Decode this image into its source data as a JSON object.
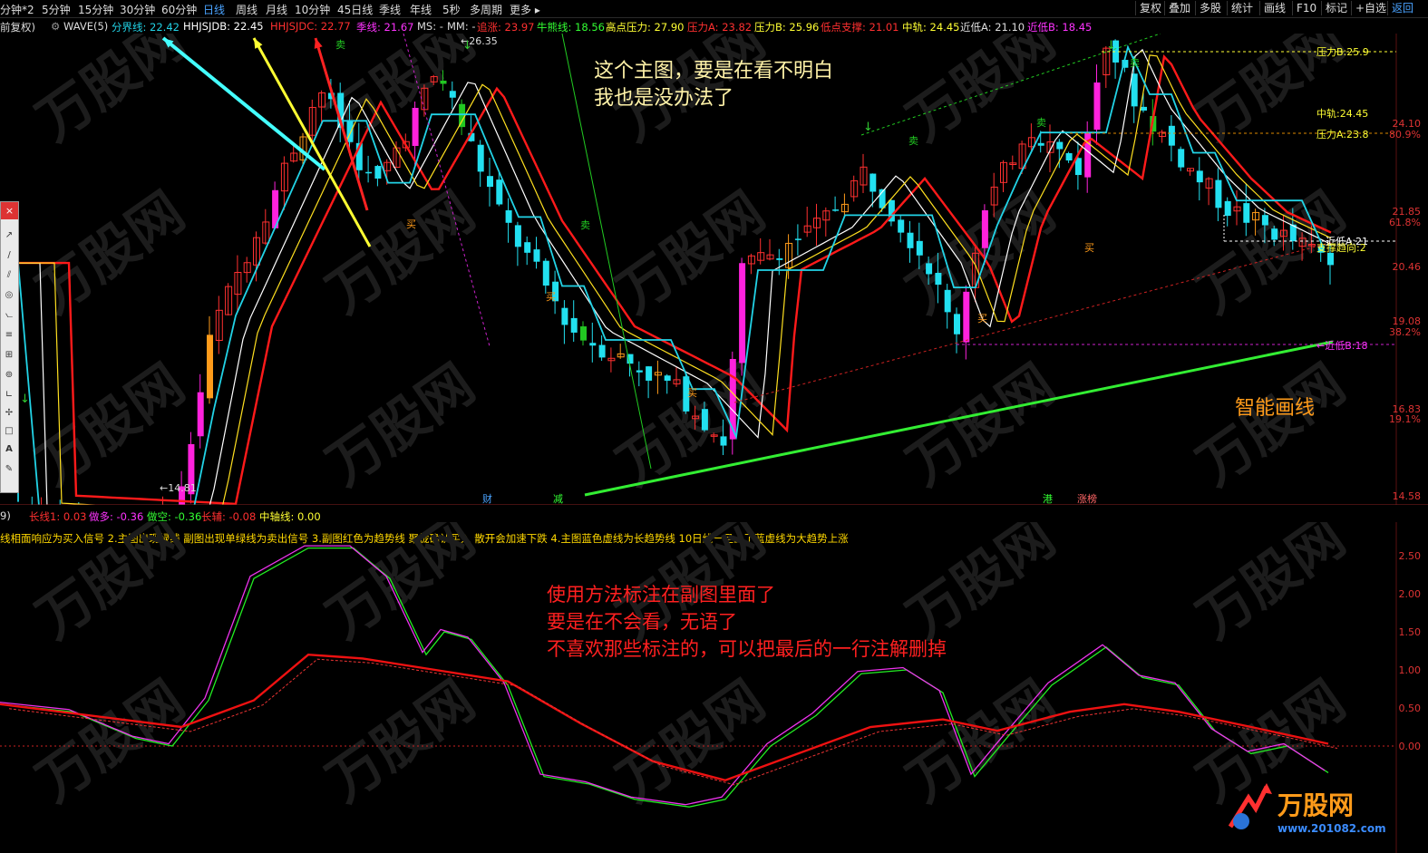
{
  "toolbar": {
    "periods": [
      "分钟*2",
      "5分钟",
      "15分钟",
      "30分钟",
      "60分钟",
      "日线",
      "周线",
      "月线",
      "10分钟",
      "45日线",
      "季线",
      "年线",
      "5秒",
      "多周期",
      "更多"
    ],
    "active_period": "日线",
    "more_label": "更多 ▸",
    "right_buttons": [
      "复权",
      "叠加",
      "多股",
      "统计",
      "画线",
      "F10",
      "标记",
      "+自选",
      "返回"
    ]
  },
  "indicator_row": {
    "rights_label": "前复权)",
    "wave_label": "WAVE(5)",
    "items": [
      {
        "label": "分界线: 22.42",
        "color": "#22d3e6"
      },
      {
        "label": "HHJSJDB: 22.45",
        "color": "#ffffff"
      },
      {
        "label": "HHJSJDC: 22.77",
        "color": "#ff3030"
      },
      {
        "label": "季线: 21.67",
        "color": "#ff33ff"
      },
      {
        "label": "MS: -",
        "color": "#dddddd"
      },
      {
        "label": "MM: -",
        "color": "#dddddd"
      },
      {
        "label": "追涨: 23.97",
        "color": "#ff3030"
      },
      {
        "label": "牛熊线: 18.56",
        "color": "#33ff33"
      },
      {
        "label": "高点压力: 27.90",
        "color": "#ffff33"
      },
      {
        "label": "压力A: 23.82",
        "color": "#ff3030"
      },
      {
        "label": "压力B: 25.96",
        "color": "#ffff33"
      },
      {
        "label": "低点支撑: 21.01",
        "color": "#ff3030"
      },
      {
        "label": "中轨: 24.45",
        "color": "#ffff33"
      },
      {
        "label": "近低A: 21.10",
        "color": "#dddddd"
      },
      {
        "label": "近低B: 18.45",
        "color": "#ff33ff"
      }
    ]
  },
  "drawing_tools": {
    "close_label": "×",
    "tools": [
      "↗",
      "/",
      "⫽",
      "◎",
      "⦦",
      "≡",
      "⊞",
      "⊚",
      "∟",
      "✢",
      "□",
      "A",
      "✎"
    ]
  },
  "main_chart": {
    "high_label": "26.35",
    "low_label": "←14.81",
    "price_scale": [
      "24.10",
      "21.85",
      "20.46",
      "19.08",
      "16.83",
      "14.58"
    ],
    "pct_scale": [
      "80.9%",
      "61.8%",
      "38.2%",
      "19.1%"
    ],
    "level_labels": [
      {
        "text": "压力B:25.9",
        "color": "#ffff33"
      },
      {
        "text": "中轨:24.45",
        "color": "#ffff33"
      },
      {
        "text": "压力A:23.8",
        "color": "#ffff33"
      },
      {
        "text": "近低A:21",
        "color": "#ffffff"
      },
      {
        "text": "支撑趋向:2",
        "color": "#ffff33"
      },
      {
        "text": "←近低B:18",
        "color": "#ff33ff"
      }
    ],
    "signals_buy": "买",
    "signals_sell": "卖",
    "event_tags": [
      {
        "text": "财",
        "color": "#4aa3ff"
      },
      {
        "text": "减",
        "color": "#33ff33"
      },
      {
        "text": "港",
        "color": "#33ff33"
      },
      {
        "text": "涨榜",
        "color": "#ff6666"
      }
    ]
  },
  "annotations": {
    "main_note_1": "这个主图，要是在看不明白",
    "main_note_2": "我也是没办法了",
    "smart_line": "智能画线",
    "sub_note_1": "使用方法标注在副图里面了",
    "sub_note_2": "要是在不会看，无语了",
    "sub_note_3": "不喜欢那些标注的，可以把最后的一行注解删掉"
  },
  "sub_chart": {
    "label_row": [
      {
        "text": "9)",
        "color": "#dddddd"
      },
      {
        "text": "长线1: 0.03",
        "color": "#ff3030"
      },
      {
        "text": "做多: -0.36",
        "color": "#ff33ff"
      },
      {
        "text": "做空: -0.36",
        "color": "#33ff33"
      },
      {
        "text": "长辅: -0.08",
        "color": "#ff3030"
      },
      {
        "text": "中轴线: 0.00",
        "color": "#ffff33"
      }
    ],
    "instructions": "线相面响应为买入信号 2.主图出现绿线 副图出现单绿线为卖出信号 3.副图红色为趋势线 聚拢确认买入 散开会加速下跌 4.主图蓝色虚线为长趋势线 10日线一旦上了蓝虚线为大趋势上涨",
    "scale": [
      "2.50",
      "2.00",
      "1.50",
      "1.00",
      "0.50",
      "0.00"
    ]
  },
  "watermark": {
    "brand": "万股网",
    "site": "www.201082.com"
  },
  "colors": {
    "up": "#ff22dd",
    "up_small": "#ff3030",
    "down": "#22e0f0",
    "sell_green": "#22c822",
    "orange": "#ff9b1a",
    "ma_red": "#ff1a1a",
    "ma_cyan": "#22d3e6",
    "ma_yellow": "#ffe020",
    "ma_white": "#ffffff",
    "trend_green": "#33ee33"
  }
}
